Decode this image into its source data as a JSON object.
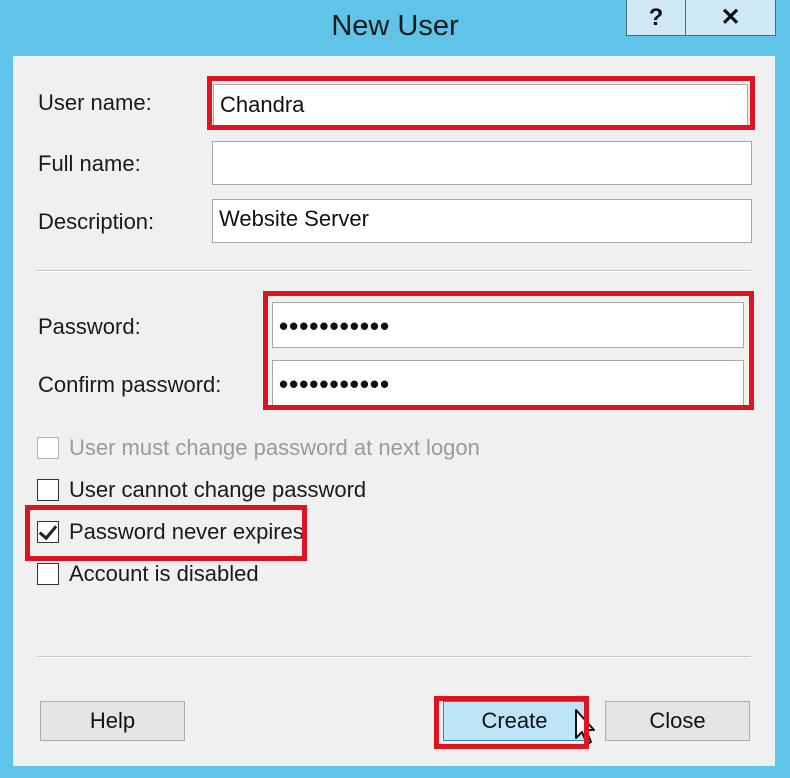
{
  "window": {
    "title": "New User"
  },
  "titlebar": {
    "help_glyph": "?",
    "close_glyph": "✕"
  },
  "form": {
    "user_name_label": "User name:",
    "user_name_value": "Chandra",
    "full_name_label": "Full name:",
    "full_name_value": "",
    "description_label": "Description:",
    "description_value": "Website Server",
    "password_label": "Password:",
    "password_value": "•••••••••••",
    "confirm_label": "Confirm password:",
    "confirm_value": "•••••••••••"
  },
  "options": [
    {
      "label": "User must change password at next logon",
      "checked": false,
      "enabled": false
    },
    {
      "label": "User cannot change password",
      "checked": false,
      "enabled": true
    },
    {
      "label": "Password never expires",
      "checked": true,
      "enabled": true
    },
    {
      "label": "Account is disabled",
      "checked": false,
      "enabled": true
    }
  ],
  "buttons": {
    "help": "Help",
    "create": "Create",
    "close": "Close"
  },
  "colors": {
    "title_bar": "#5fc4e8",
    "highlight": "#e0141e",
    "primary_button": "#bde4f8"
  },
  "icons": {
    "checkbox_checked": "check-icon",
    "cursor": "mouse-cursor-icon"
  }
}
